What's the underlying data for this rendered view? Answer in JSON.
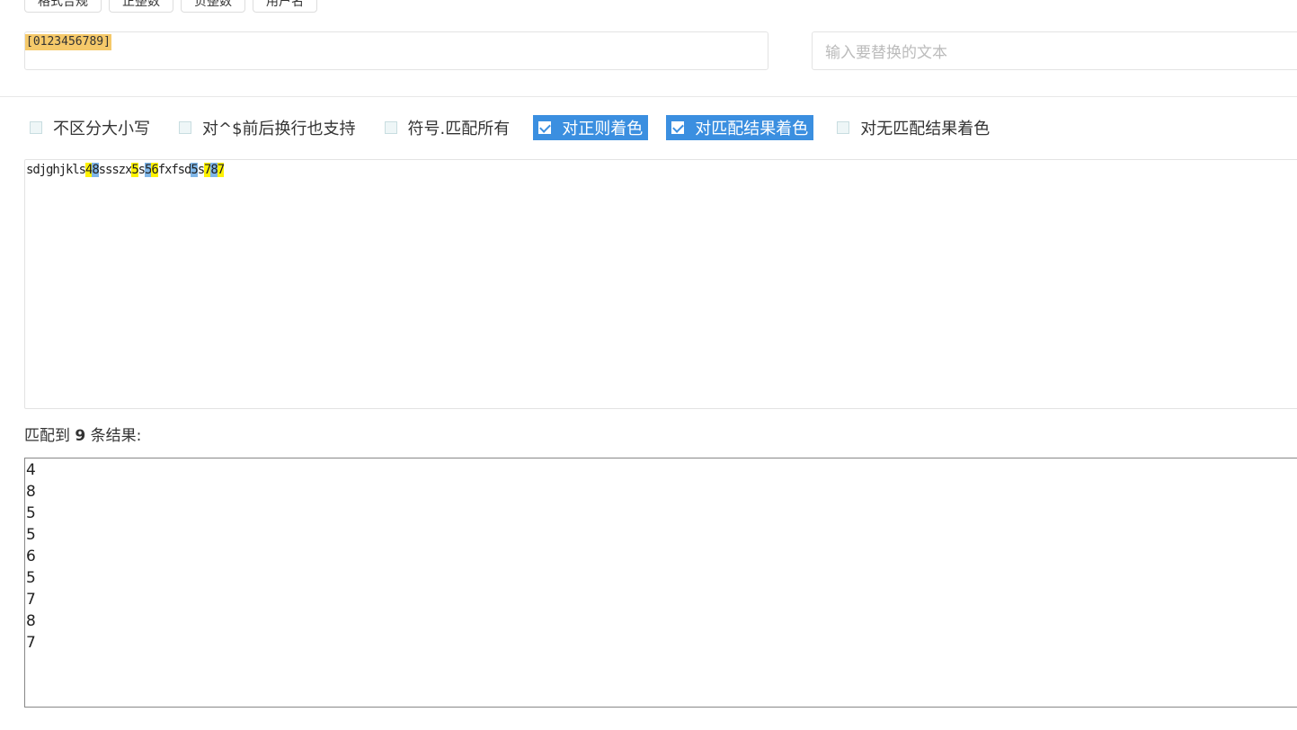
{
  "toolbar": {
    "buttons": [
      {
        "label": "格式合规"
      },
      {
        "label": "正整数"
      },
      {
        "label": "负整数"
      },
      {
        "label": "用户名"
      }
    ]
  },
  "regex": {
    "value": "[0123456789]"
  },
  "replace": {
    "placeholder": "输入要替换的文本"
  },
  "options": [
    {
      "label": "不区分大小写",
      "checked": false
    },
    {
      "label": "对^$前后换行也支持",
      "checked": false
    },
    {
      "label": "符号.匹配所有",
      "checked": false
    },
    {
      "label": "对正则着色",
      "checked": true
    },
    {
      "label": "对匹配结果着色",
      "checked": true
    },
    {
      "label": "对无匹配结果着色",
      "checked": false
    }
  ],
  "test_text": {
    "segments": [
      {
        "t": "sdjghjkls",
        "hl": ""
      },
      {
        "t": "4",
        "hl": "y"
      },
      {
        "t": "8",
        "hl": "b"
      },
      {
        "t": "ssszx",
        "hl": ""
      },
      {
        "t": "5",
        "hl": "y"
      },
      {
        "t": "s",
        "hl": ""
      },
      {
        "t": "5",
        "hl": "b"
      },
      {
        "t": "6",
        "hl": "y"
      },
      {
        "t": "fxfsd",
        "hl": ""
      },
      {
        "t": "5",
        "hl": "b"
      },
      {
        "t": "s",
        "hl": ""
      },
      {
        "t": "7",
        "hl": "y"
      },
      {
        "t": "8",
        "hl": "b"
      },
      {
        "t": "7",
        "hl": "y"
      }
    ]
  },
  "results": {
    "prefix": "匹配到",
    "count": "9",
    "suffix": "条结果:",
    "items": [
      "4",
      "8",
      "5",
      "5",
      "6",
      "5",
      "7",
      "8",
      "7"
    ]
  },
  "colors": {
    "accent": "#3b8fe0",
    "highlight_yellow": "#fff200",
    "highlight_blue": "#7fb6e8",
    "regex_highlight": "#f5c96a"
  }
}
